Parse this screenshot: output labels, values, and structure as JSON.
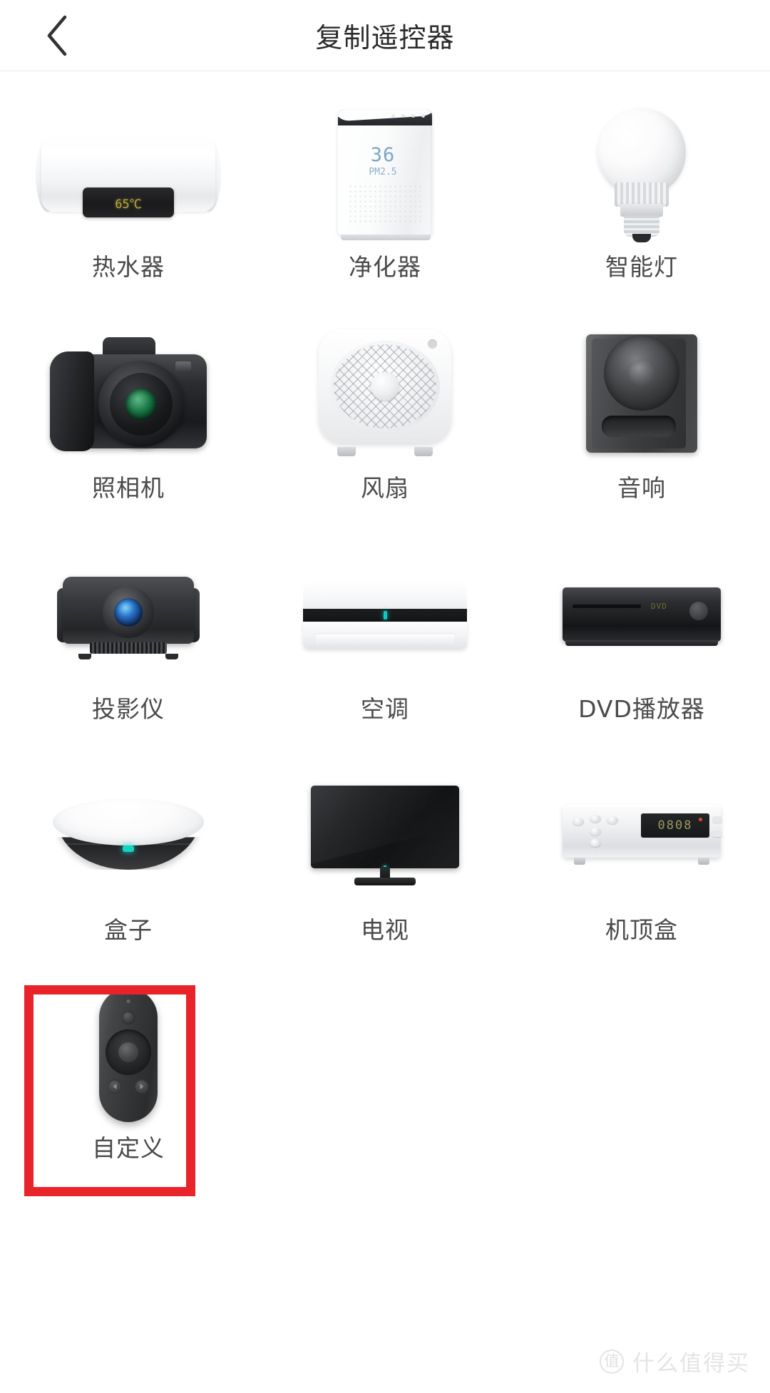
{
  "header": {
    "title": "复制遥控器",
    "back_icon": "chevron-left-icon"
  },
  "devices": [
    [
      {
        "label": "热水器",
        "icon": "water-heater-icon",
        "display": "65℃"
      },
      {
        "label": "净化器",
        "icon": "air-purifier-icon",
        "value": "36",
        "unit": "PM2.5"
      },
      {
        "label": "智能灯",
        "icon": "smart-bulb-icon"
      }
    ],
    [
      {
        "label": "照相机",
        "icon": "camera-icon"
      },
      {
        "label": "风扇",
        "icon": "fan-icon"
      },
      {
        "label": "音响",
        "icon": "speaker-icon"
      }
    ],
    [
      {
        "label": "投影仪",
        "icon": "projector-icon"
      },
      {
        "label": "空调",
        "icon": "air-conditioner-icon"
      },
      {
        "label": "DVD播放器",
        "icon": "dvd-player-icon"
      }
    ],
    [
      {
        "label": "盒子",
        "icon": "tv-box-icon"
      },
      {
        "label": "电视",
        "icon": "television-icon"
      },
      {
        "label": "机顶盒",
        "icon": "set-top-box-icon",
        "display": "0808"
      }
    ]
  ],
  "custom": {
    "label": "自定义",
    "icon": "custom-remote-icon",
    "highlight_color": "#e8242a",
    "highlighted": true
  },
  "dvd_display": "DVD",
  "watermark": {
    "logo": "值",
    "text": "什么值得买"
  },
  "colors": {
    "background": "#ffffff",
    "title": "#2b2b2b",
    "caption": "#4a4a4a",
    "highlight": "#e8242a",
    "led_teal": "#14c8bc",
    "purifier_blue": "#7fa6c4",
    "heater_amber": "#b6a93c"
  }
}
